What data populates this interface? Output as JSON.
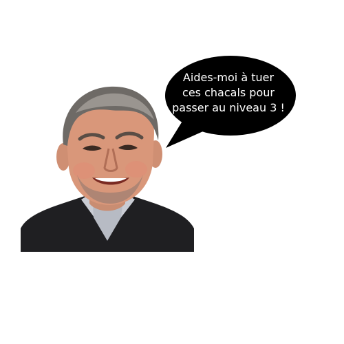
{
  "speech_bubble": {
    "lines": [
      "Aides-moi à tuer",
      "ces chacals pour",
      "passer au niveau 3 !"
    ],
    "background_color": "#000000",
    "text_color": "#ffffff"
  },
  "portrait": {
    "subject": "smiling man with grey hair and stubble, dark jacket, light collared shirt",
    "background_color": "#ffffff"
  }
}
